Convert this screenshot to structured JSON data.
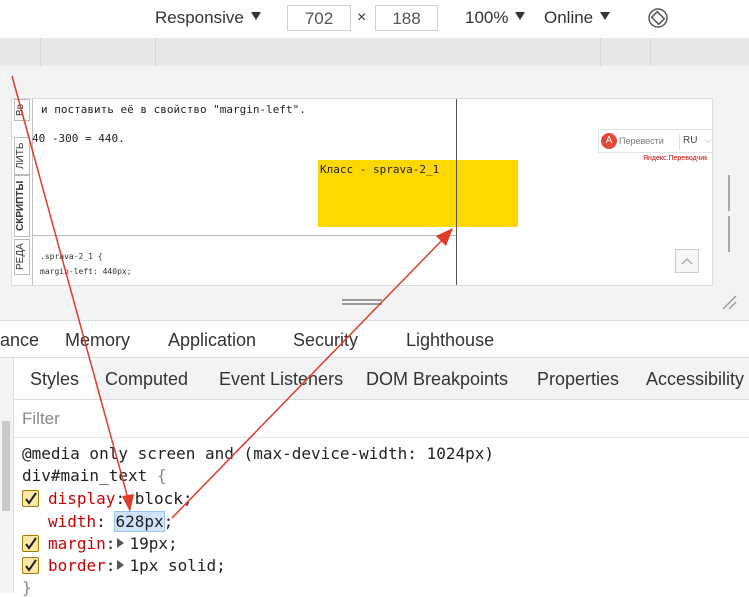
{
  "device_toolbar": {
    "device_label": "Responsive",
    "width_value": "702",
    "times_sign": "×",
    "height_value": "188",
    "zoom_label": "100%",
    "throttle_label": "Online",
    "rotate_icon": "rotate-icon"
  },
  "page": {
    "vertical_tabs": [
      "Вв",
      "ЛИТЬ",
      "СКРИПТЫ",
      "РЕДА"
    ],
    "text_line_1": "и поставить её в свойство \"margin-left\".",
    "text_line_2": "40 -300 = 440.",
    "css_lines": [
      ".sprava-2_1 {",
      "margin-left: 440px;"
    ],
    "yellow_box_text": "Класс - sprava-2_1",
    "yellow_color": "#ffd800",
    "translate_button": "Перевести",
    "language_label": "RU",
    "yandex_label": "Яндекс.Переводчик"
  },
  "panel_tabs": [
    "ance",
    "Memory",
    "Application",
    "Security",
    "Lighthouse"
  ],
  "sub_tabs": {
    "active": "Styles",
    "items": [
      "Computed",
      "Event Listeners",
      "DOM Breakpoints",
      "Properties",
      "Accessibility"
    ]
  },
  "filter": {
    "placeholder": "Filter"
  },
  "styles_pane": {
    "media_query": "@media only screen and (max-device-width: 1024px)",
    "selector": "div#main_text",
    "open_brace": "{",
    "close_brace": "}",
    "declarations": [
      {
        "checked": true,
        "property": "display",
        "value": "block",
        "expandable": false
      },
      {
        "checked": false,
        "property": "width",
        "value": "628px",
        "expandable": false,
        "selected": true
      },
      {
        "checked": true,
        "property": "margin",
        "value": "19px",
        "expandable": true
      },
      {
        "checked": true,
        "property": "border",
        "value": "1px solid",
        "expandable": true
      }
    ]
  },
  "annotation_color": "#e03c28"
}
